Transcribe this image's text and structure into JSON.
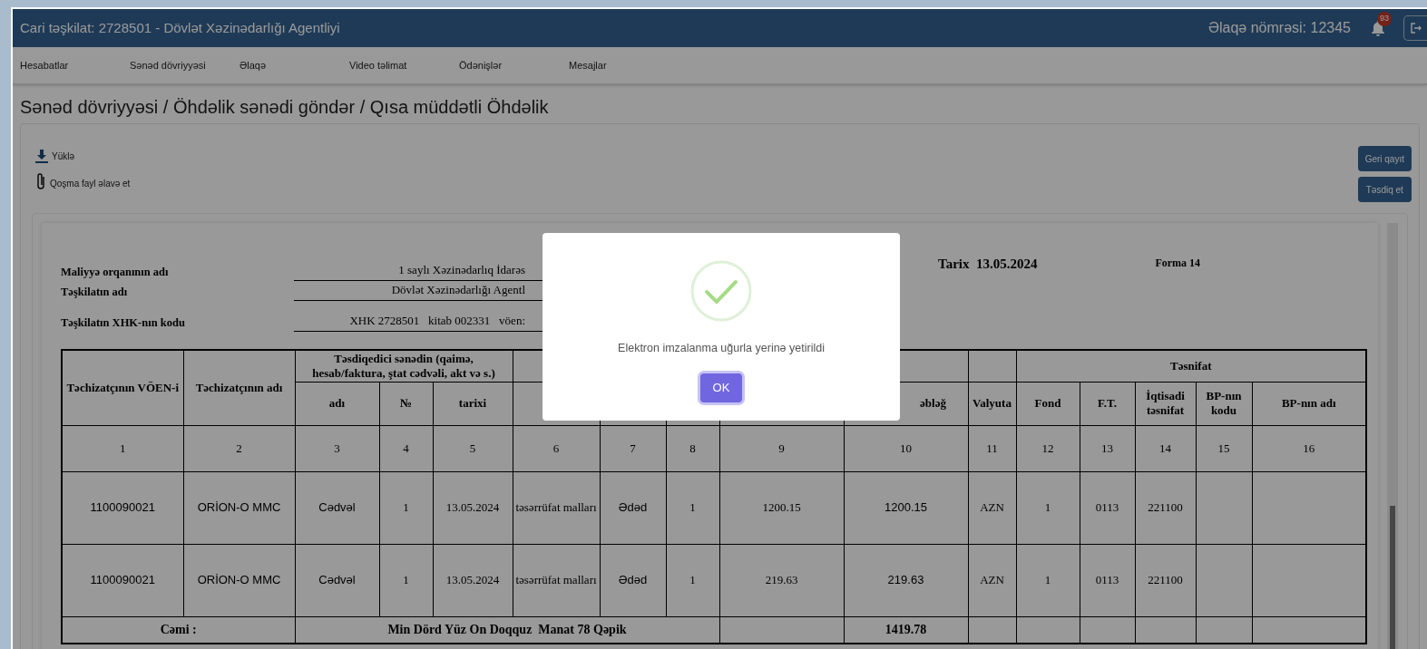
{
  "header": {
    "title": "Cari təşkilat: 2728501 - Dövlət Xəzinədarlığı Agentliyi",
    "contact": "Əlaqə nömrəsi: 12345",
    "notification_count": "93"
  },
  "nav": [
    "Hesabatlar",
    "Sənəd dövriyyəsi",
    "Əlaqə",
    "Video təlimat",
    "Ödənişlər",
    "Mesajlar"
  ],
  "breadcrumb": "Sənəd dövriyyəsi / Öhdəlik sənədi göndər / Qısa müddətli Öhdəlik",
  "actions": [
    {
      "kind": "download",
      "label": "Yüklə"
    },
    {
      "kind": "attach",
      "label": "Qoşma fayl əlavə et"
    }
  ],
  "buttons": [
    "Geri qayıt",
    "Təsdiq et"
  ],
  "document": {
    "info": [
      {
        "label": "Maliyyə orqanının adı",
        "value": "1 saylı Xəzinədarlıq İdarəs"
      },
      {
        "label": "Təşkilatın adı",
        "value": "Dövlət Xəzinədarlığı Agentl"
      },
      {
        "label": "Təşkilatın XHK-nın kodu",
        "value": "XHK 2728501   kitab 002331   vöen:"
      }
    ],
    "date": "Tarix  13.05.2024",
    "form": "Forma 14",
    "groups": [
      "Təsdiqedici sənədin (qaimə, hesab/faktura, ştat cədvəli, akt və s.)",
      "Təsnifat"
    ],
    "columns": [
      {
        "number": "1",
        "label": "Təchizatçının VÖEN-i"
      },
      {
        "number": "2",
        "label": "Təchizatçının adı"
      },
      {
        "number": "3",
        "label": "adı"
      },
      {
        "number": "4",
        "label": "№"
      },
      {
        "number": "5",
        "label": "tarixi"
      },
      {
        "number": "6"
      },
      {
        "number": "7"
      },
      {
        "number": "8"
      },
      {
        "number": "9"
      },
      {
        "number": "10",
        "label": "əbləğ"
      },
      {
        "number": "11",
        "label": "Valyuta"
      },
      {
        "number": "12",
        "label": "Fond"
      },
      {
        "number": "13",
        "label": "F.T."
      },
      {
        "number": "14",
        "label": "İqtisadi təsnifat"
      },
      {
        "number": "15",
        "label": "BP-nın kodu"
      },
      {
        "number": "16",
        "label": "BP-nın adı"
      }
    ],
    "rows": [
      [
        "1100090021",
        "ORİON-O MMC",
        "Cədvəl",
        "1",
        "13.05.2024",
        "təsərrüfat malları",
        "Ədəd",
        "1",
        "1200.15",
        "1200.15",
        "AZN",
        "1",
        "0113",
        "221100",
        "",
        ""
      ],
      [
        "1100090021",
        "ORİON-O MMC",
        "Cədvəl",
        "1",
        "13.05.2024",
        "təsərrüfat malları",
        "Ədəd",
        "1",
        "219.63",
        "219.63",
        "AZN",
        "1",
        "0113",
        "221100",
        "",
        ""
      ]
    ],
    "total": {
      "label": "Cəmi :",
      "words": "Min Dörd Yüz On Doqquz  Manat 78 Qəpik",
      "amount": "1419.78"
    }
  },
  "modal": {
    "message": "Elektron imzalanma uğurla yerinə yetirildi",
    "button": "OK"
  }
}
